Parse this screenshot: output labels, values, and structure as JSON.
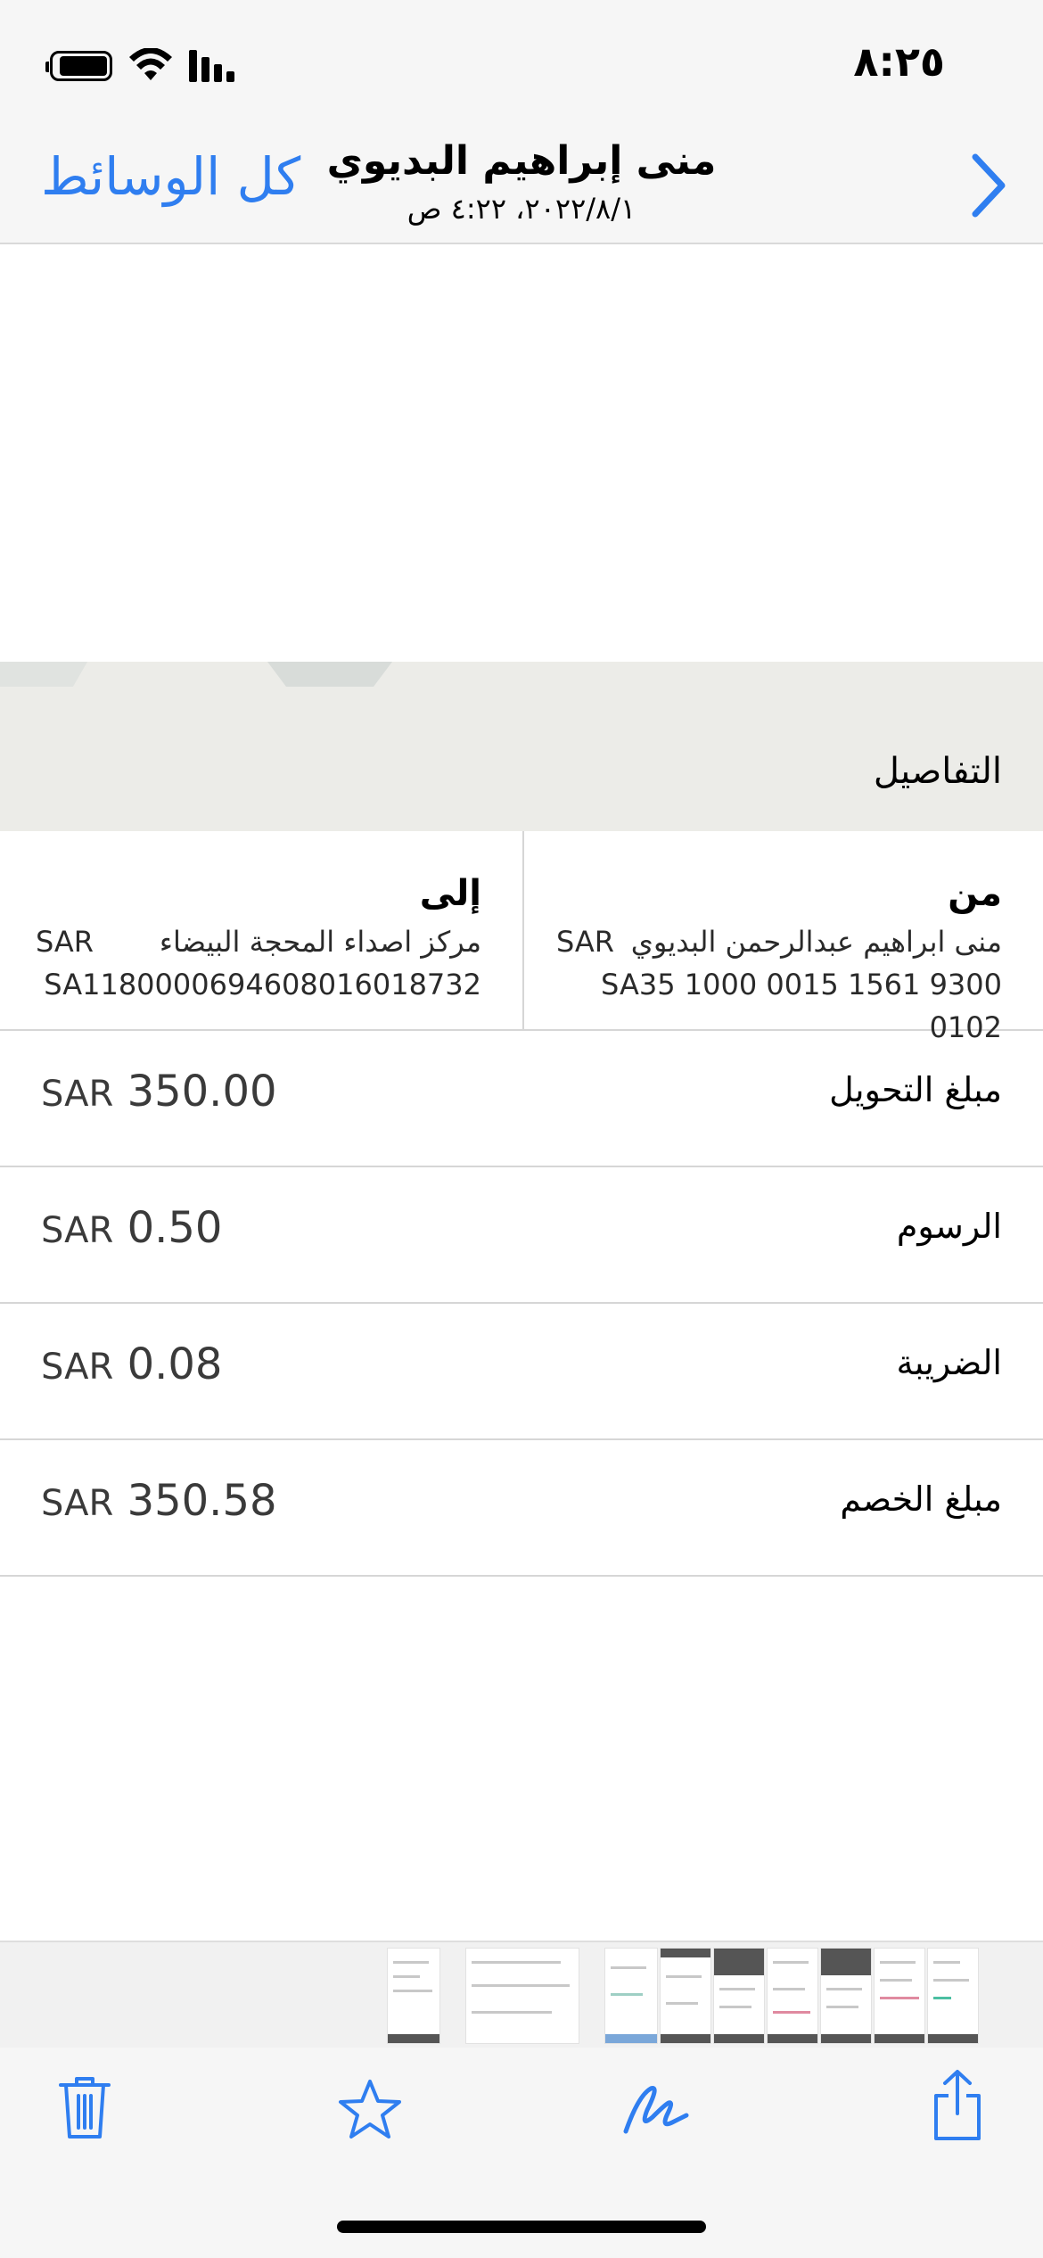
{
  "status_bar": {
    "time": "٨:٢٥",
    "icons": [
      "battery-icon",
      "wifi-icon",
      "cellular-signal-icon"
    ]
  },
  "nav": {
    "back_label": "كل الوسائط",
    "title": "منى إبراهيم البديوي",
    "subtitle": "٢٠٢٢/٨/١، ٤:٢٢ ص",
    "forward_icon": "chevron-right-icon"
  },
  "details": {
    "section_title": "التفاصيل",
    "from": {
      "heading": "من",
      "name": "منى ابراهيم عبدالرحمن البديوي",
      "currency": "SAR",
      "iban": "SA35 1000 0015 1561 9300 0102"
    },
    "to": {
      "heading": "إلى",
      "name": "مركز اصداء المحجة البيضاء",
      "currency": "SAR",
      "iban": "SA1180000694608016018732"
    },
    "rows": [
      {
        "label": "مبلغ التحويل",
        "currency": "SAR",
        "amount": "350.00"
      },
      {
        "label": "الرسوم",
        "currency": "SAR",
        "amount": "0.50"
      },
      {
        "label": "الضريبة",
        "currency": "SAR",
        "amount": "0.08"
      },
      {
        "label": "مبلغ الخصم",
        "currency": "SAR",
        "amount": "350.58"
      }
    ]
  },
  "toolbar": {
    "icons": [
      "trash-icon",
      "star-icon",
      "markup-icon",
      "share-icon"
    ]
  },
  "colors": {
    "accent": "#2f7ef0",
    "bar_background": "#f6f6f6",
    "band_background": "#ecece8"
  }
}
